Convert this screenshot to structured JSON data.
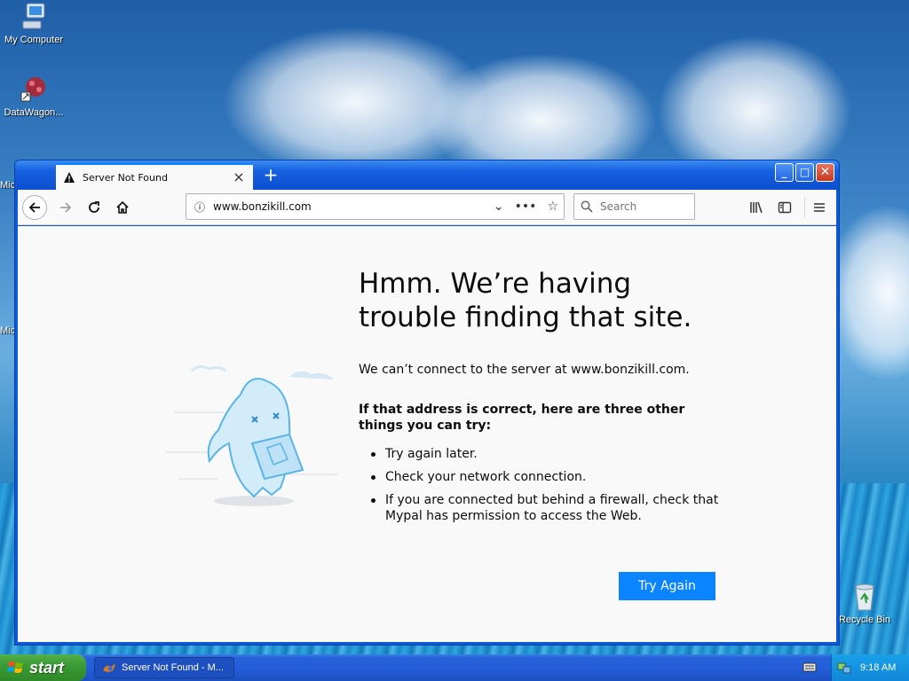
{
  "desktop": {
    "icons": [
      {
        "label": "My Computer",
        "icon": "computer-icon"
      },
      {
        "label": "DataWagon...",
        "icon": "datawagon-icon"
      },
      {
        "label": "Recycle Bin",
        "icon": "recycle-bin-icon"
      }
    ],
    "partial_labels": [
      "Mic",
      "Mic"
    ]
  },
  "browser": {
    "tab_title": "Server Not Found",
    "url": "www.bonzikill.com",
    "search_placeholder": "Search",
    "error": {
      "title": "Hmm. We’re having trouble finding that site.",
      "description": "We can’t connect to the server at www.bonzikill.com.",
      "suggestions_heading": "If that address is correct, here are three other things you can try:",
      "suggestions": [
        "Try again later.",
        "Check your network connection.",
        "If you are connected but behind a firewall, check that Mypal has permission to access the Web."
      ],
      "button_label": "Try Again"
    }
  },
  "taskbar": {
    "start_label": "start",
    "task_label": "Server Not Found - M...",
    "clock": "9:18 AM"
  },
  "colors": {
    "accent": "#0a84ff",
    "taskbar": "#245edb",
    "start": "#3a9a33"
  }
}
